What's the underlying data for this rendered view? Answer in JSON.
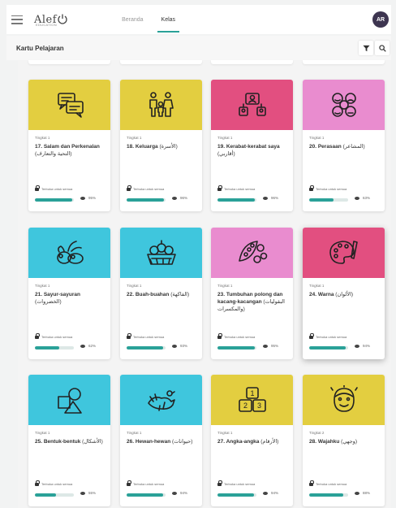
{
  "header": {
    "logo": "Alef",
    "logo_sub": "EDUCATION",
    "tabs": [
      {
        "label": "Beranda",
        "active": false
      },
      {
        "label": "Kelas",
        "active": true
      }
    ],
    "avatar": "AR",
    "avatar_color": "#3d3550"
  },
  "subheader": {
    "title": "Kartu Pelajaran",
    "filter_icon": "filter-icon",
    "search_icon": "search-icon"
  },
  "accent_color": "#2aa198",
  "status_text": "Terbuka untuk semua",
  "cards": [
    {
      "level": "Tingkat 1",
      "title": "17. Salam dan Perkenalan",
      "arabic": "(التحية والتعارف)",
      "progress": 95,
      "color": "#e3ce40",
      "icon": "chat-bubbles-icon"
    },
    {
      "level": "Tingkat 1",
      "title": "18. Keluarga",
      "arabic": "(الأسرة)",
      "progress": 96,
      "color": "#e3ce40",
      "icon": "family-icon"
    },
    {
      "level": "Tingkat 1",
      "title": "19. Kerabat-kerabat saya",
      "arabic": "(أقاربي)",
      "progress": 96,
      "color": "#e24f80",
      "icon": "relatives-icon"
    },
    {
      "level": "Tingkat 1",
      "title": "20. Perasaan",
      "arabic": "(المشاعر)",
      "progress": 63,
      "color": "#e98ccf",
      "icon": "emotions-icon"
    },
    {
      "level": "Tingkat 1",
      "title": "21. Sayur-sayuran",
      "arabic": "(الخضروات)",
      "progress": 62,
      "color": "#3fc6dd",
      "icon": "vegetables-icon"
    },
    {
      "level": "Tingkat 1",
      "title": "22. Buah-buahan",
      "arabic": "(الفاكهة)",
      "progress": 93,
      "color": "#3fc6dd",
      "icon": "fruit-basket-icon"
    },
    {
      "level": "Tingkat 1",
      "title": "23. Tumbuhan polong dan kacang-kacangan",
      "arabic": "(البقوليات والمكسرات)",
      "progress": 95,
      "color": "#e98ccf",
      "icon": "legumes-nuts-icon"
    },
    {
      "level": "Tingkat 1",
      "title": "24. Warna",
      "arabic": "(الألوان)",
      "progress": 94,
      "color": "#e24f80",
      "icon": "palette-icon"
    },
    {
      "level": "Tingkat 1",
      "title": "25. Bentuk-bentuk",
      "arabic": "(الأشكال)",
      "progress": 55,
      "color": "#3fc6dd",
      "icon": "shapes-icon"
    },
    {
      "level": "Tingkat 1",
      "title": "26. Hewan-hewan",
      "arabic": "(حيوانات)",
      "progress": 94,
      "color": "#3fc6dd",
      "icon": "animals-icon"
    },
    {
      "level": "Tingkat 1",
      "title": "27. Angka-angka",
      "arabic": "(الأرقام)",
      "progress": 94,
      "color": "#e3ce40",
      "icon": "number-blocks-icon"
    },
    {
      "level": "Tingkat 2",
      "title": "28. Wajahku",
      "arabic": "(وجهي)",
      "progress": 88,
      "color": "#e3ce40",
      "icon": "face-icon"
    }
  ]
}
